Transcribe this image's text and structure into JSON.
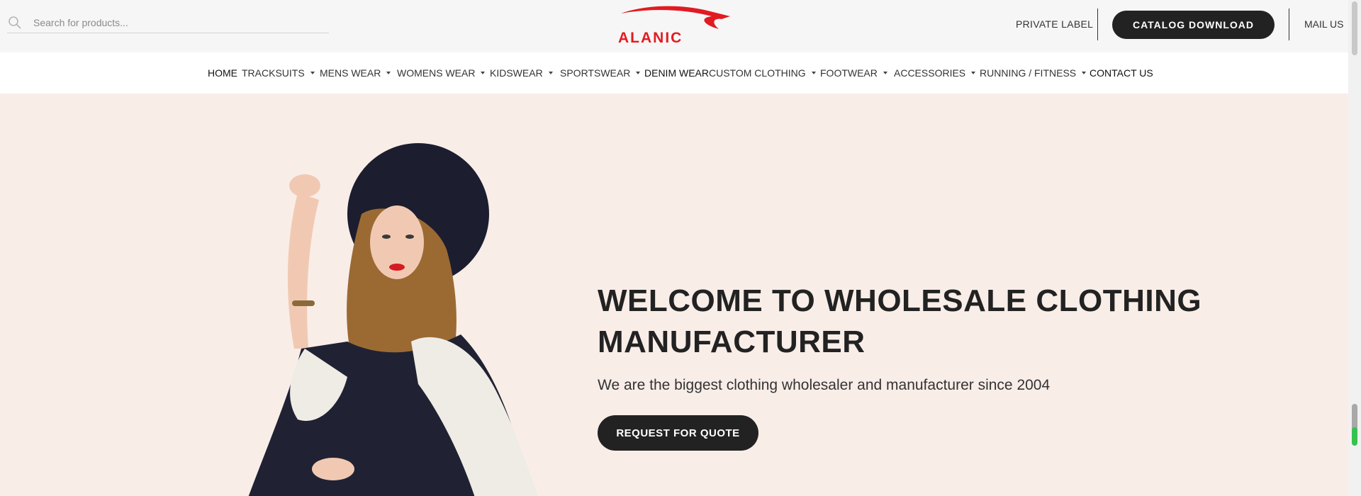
{
  "search": {
    "placeholder": "Search for products..."
  },
  "logo": {
    "text": "ALANIC",
    "color": "#e11b22"
  },
  "top_links": {
    "private_label": "PRIVATE LABEL",
    "catalog_download": "CATALOG DOWNLOAD",
    "mail_us": "MAIL US"
  },
  "nav": [
    {
      "label": "HOME",
      "has_dropdown": false,
      "active": true
    },
    {
      "label": "TRACKSUITS",
      "has_dropdown": true
    },
    {
      "label": "MENS WEAR",
      "has_dropdown": true
    },
    {
      "label": "WOMENS WEAR",
      "has_dropdown": true
    },
    {
      "label": "KIDSWEAR",
      "has_dropdown": true
    },
    {
      "label": "SPORTSWEAR",
      "has_dropdown": true
    },
    {
      "label": "DENIM WEAR",
      "has_dropdown": false,
      "active": true
    },
    {
      "label": "CUSTOM CLOTHING",
      "has_dropdown": true
    },
    {
      "label": "FOOTWEAR",
      "has_dropdown": true
    },
    {
      "label": "ACCESSORIES",
      "has_dropdown": true
    },
    {
      "label": "RUNNING / FITNESS",
      "has_dropdown": true
    },
    {
      "label": "CONTACT US",
      "has_dropdown": false,
      "active": true
    }
  ],
  "hero": {
    "title_line1": "WELCOME TO WHOLESALE CLOTHING",
    "title_line2": "MANUFACTURER",
    "subtitle": "We are the biggest clothing wholesaler and manufacturer since 2004",
    "cta": "REQUEST FOR QUOTE"
  },
  "colors": {
    "hero_bg": "#f9ede8",
    "topbar_bg": "#f6f6f6",
    "button_dark": "#222222"
  }
}
